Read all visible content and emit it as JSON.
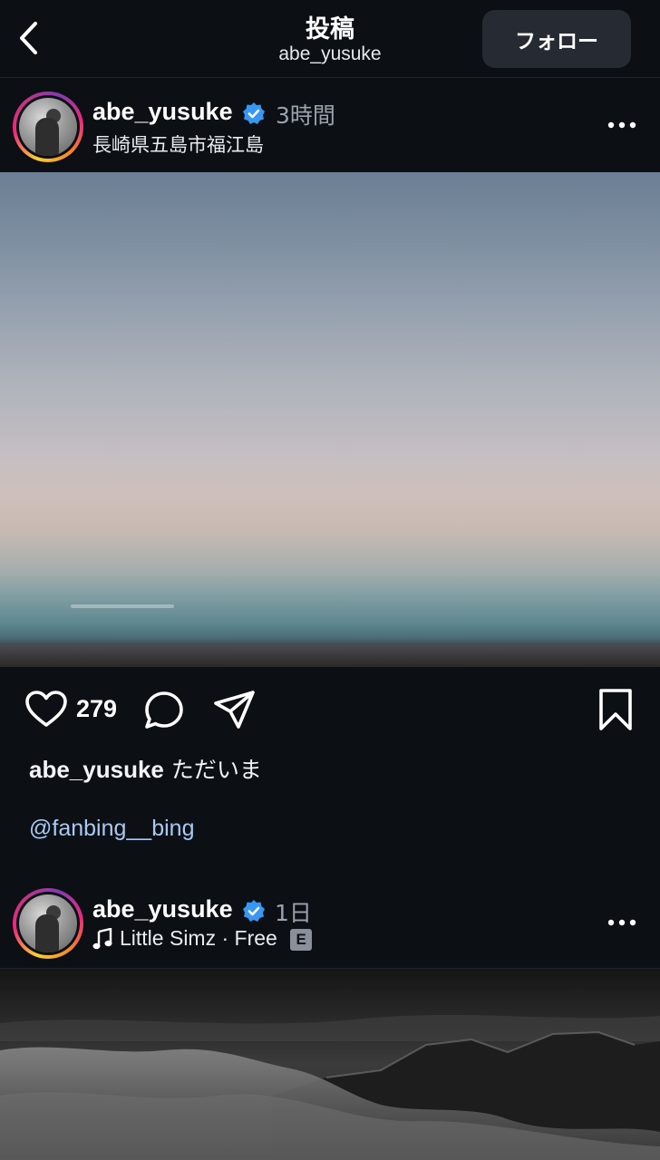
{
  "nav": {
    "title": "投稿",
    "subtitle": "abe_yusuke",
    "follow_label": "フォロー"
  },
  "post1": {
    "username": "abe_yusuke",
    "time": "3時間",
    "location": "長崎県五島市福江島",
    "likes": "279",
    "caption_user": "abe_yusuke",
    "caption_text": "ただいま",
    "mention": "@fanbing__bing"
  },
  "post2": {
    "username": "abe_yusuke",
    "time": "1日",
    "music": "Little Simz · Free",
    "explicit_badge": "E"
  },
  "colors": {
    "background": "#0c1015",
    "verified": "#3897f0",
    "mention": "#a8c9f5",
    "follow_bg": "#262b33"
  },
  "icons": [
    "chevron-left-icon",
    "verified-icon",
    "more-icon",
    "heart-icon",
    "comment-icon",
    "share-icon",
    "bookmark-icon",
    "music-icon"
  ]
}
